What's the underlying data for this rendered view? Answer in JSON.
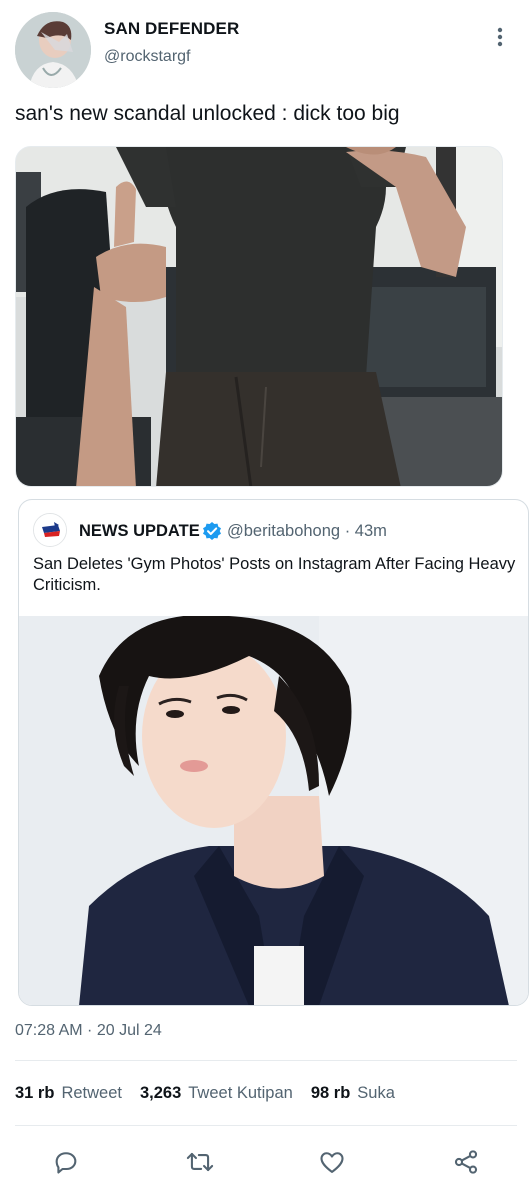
{
  "author": {
    "display_name": "SAN DEFENDER",
    "handle": "@rockstargf"
  },
  "tweet": {
    "text": "san's new scandal unlocked : dick too big"
  },
  "quote": {
    "name": "NEWS UPDATE",
    "handle": "@beritabohong",
    "separator": "·",
    "time": "43m",
    "text": "San Deletes 'Gym Photos' Posts on Instagram After Facing Heavy Criticism."
  },
  "meta": {
    "timestamp": "07:28 AM · 20 Jul 24"
  },
  "stats": [
    {
      "value": "31 rb",
      "label": "Retweet"
    },
    {
      "value": "3,263",
      "label": "Tweet Kutipan"
    },
    {
      "value": "98 rb",
      "label": "Suka"
    }
  ],
  "icons": {
    "more": "more-vertical-icon",
    "verified": "verified-badge-icon",
    "reply": "reply-icon",
    "retweet": "retweet-icon",
    "like": "heart-icon",
    "share": "share-icon"
  },
  "colors": {
    "verified": "#1d9bf0",
    "text": "#0f1419",
    "muted": "#536471"
  }
}
